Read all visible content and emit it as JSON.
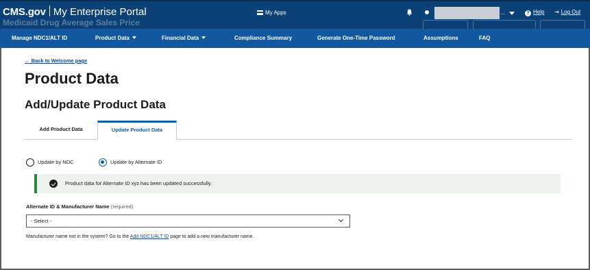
{
  "header": {
    "brand": "CMS.gov",
    "portal_name": "My Enterprise Portal",
    "ghost_title": "Medicaid Drug Average Sales Price",
    "my_apps_label": "My Apps",
    "user_name_trail": "...",
    "help_label": "Help",
    "logout_label": "Log Out"
  },
  "nav": {
    "items": [
      {
        "label": "Manage NDC1/ALT ID",
        "dropdown": false
      },
      {
        "label": "Product Data",
        "dropdown": true
      },
      {
        "label": "Financial Data",
        "dropdown": true
      },
      {
        "label": "Compliance Summary",
        "dropdown": false
      },
      {
        "label": "Generate One-Time Password",
        "dropdown": false
      },
      {
        "label": "Assumptions",
        "dropdown": false
      },
      {
        "label": "FAQ",
        "dropdown": false
      }
    ]
  },
  "content": {
    "back_link": "← Back to Welcome page",
    "page_title": "Product Data",
    "section_title": "Add/Update Product Data",
    "tabs": [
      {
        "label": "Add Product Data",
        "active": false
      },
      {
        "label": "Update Product Data",
        "active": true
      }
    ],
    "radio_options": [
      {
        "label": "Update by NDC",
        "checked": false
      },
      {
        "label": "Update by Alternate ID",
        "checked": true
      }
    ],
    "alert": {
      "type": "success",
      "message": "Product data for Alternate ID xyz has been updated successfully."
    },
    "field": {
      "label": "Alternate ID & Manufacturer Name",
      "required_text": "(required)",
      "selected_value": "- Select -"
    },
    "hint": {
      "prefix": "Manufacturer name not in the system? Go to the ",
      "link_text": "Add NDC1/ALT ID",
      "suffix": " page to add a new manufacturer name."
    }
  },
  "colors": {
    "topbar": "#0b4177",
    "nav": "#12589f",
    "accent": "#0b5fa5",
    "success": "#2e8540",
    "success_bg": "#ecf3ec"
  }
}
